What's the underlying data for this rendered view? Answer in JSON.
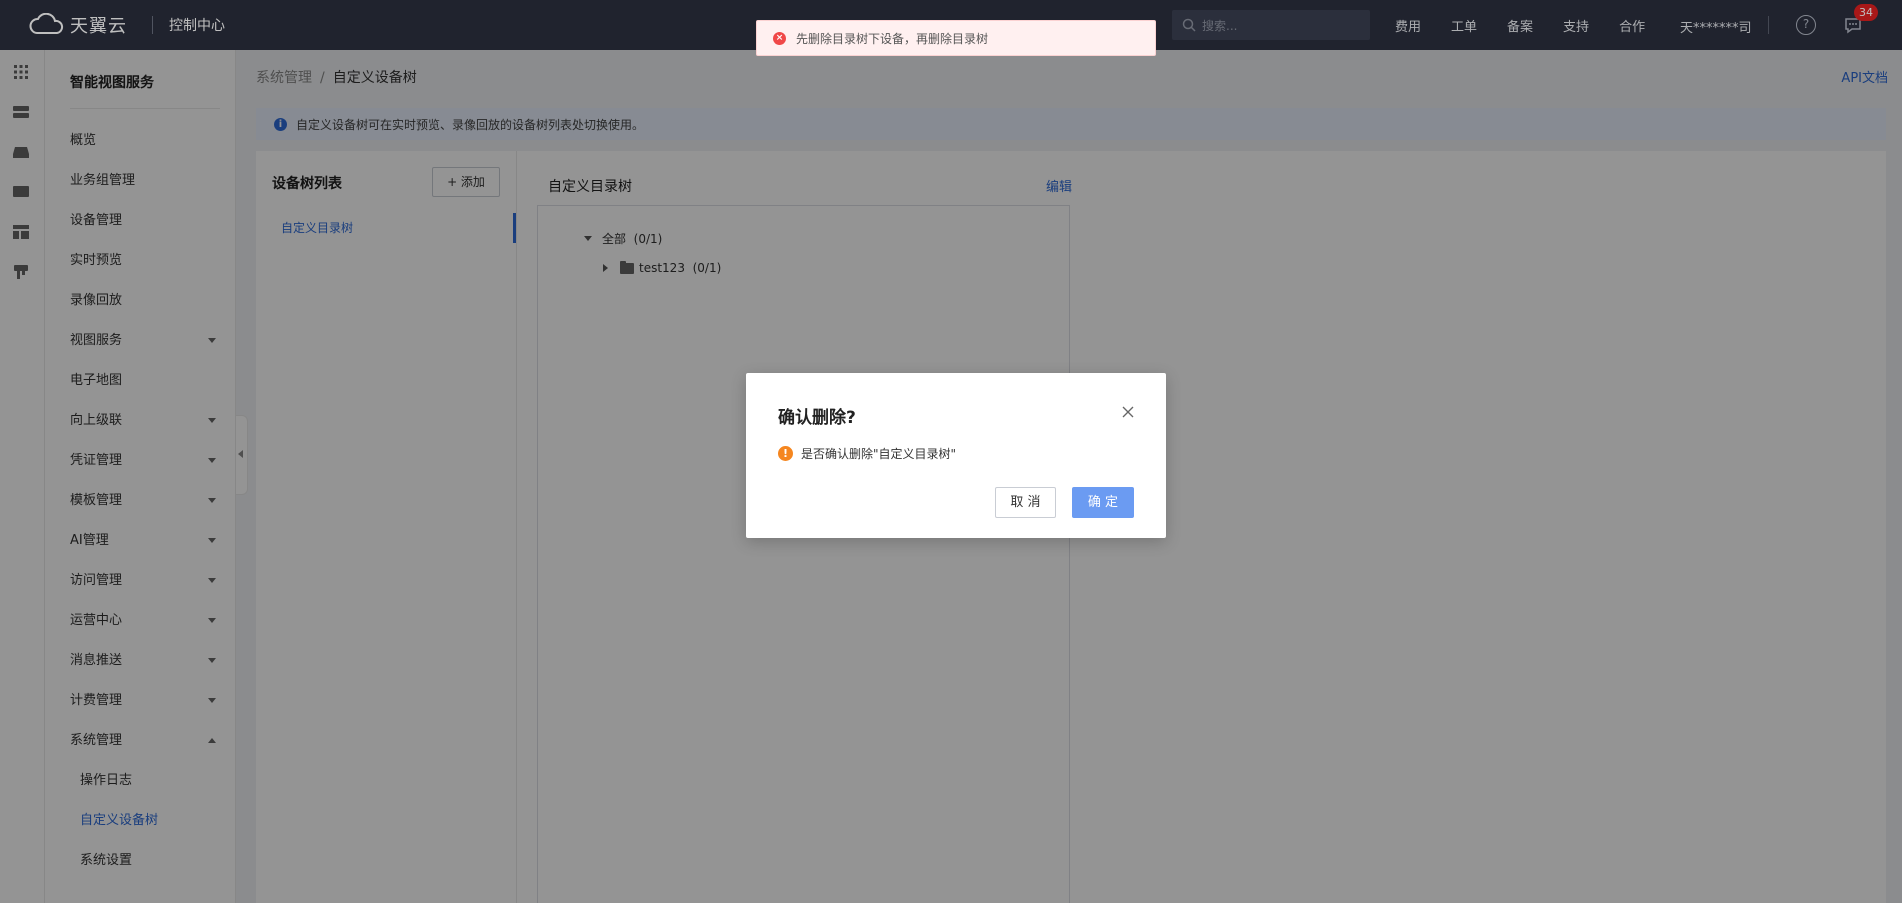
{
  "topbar": {
    "logo_text": "天翼云",
    "console_title": "控制中心",
    "search_placeholder": "搜索...",
    "nav": [
      "费用",
      "工单",
      "备案",
      "支持",
      "合作"
    ],
    "user": "天*******司",
    "help": "?",
    "message_count": "34"
  },
  "sidebar": {
    "title": "智能视图服务",
    "items": [
      {
        "label": "概览",
        "expandable": false
      },
      {
        "label": "业务组管理",
        "expandable": false
      },
      {
        "label": "设备管理",
        "expandable": false
      },
      {
        "label": "实时预览",
        "expandable": false
      },
      {
        "label": "录像回放",
        "expandable": false
      },
      {
        "label": "视图服务",
        "expandable": true
      },
      {
        "label": "电子地图",
        "expandable": false
      },
      {
        "label": "向上级联",
        "expandable": true
      },
      {
        "label": "凭证管理",
        "expandable": true
      },
      {
        "label": "模板管理",
        "expandable": true
      },
      {
        "label": "AI管理",
        "expandable": true
      },
      {
        "label": "访问管理",
        "expandable": true
      },
      {
        "label": "运营中心",
        "expandable": true
      },
      {
        "label": "消息推送",
        "expandable": true
      },
      {
        "label": "计费管理",
        "expandable": true
      },
      {
        "label": "系统管理",
        "expandable": true,
        "expanded": true
      }
    ],
    "sub_items": [
      "操作日志",
      "自定义设备树",
      "系统设置"
    ],
    "active_sub": "自定义设备树"
  },
  "breadcrumb": {
    "parent": "系统管理",
    "sep": "/",
    "current": "自定义设备树"
  },
  "api_link": "API文档",
  "info": {
    "icon": "i",
    "text": "自定义设备树可在实时预览、录像回放的设备树列表处切换使用。"
  },
  "left_panel": {
    "title": "设备树列表",
    "add_label": "+ 添加",
    "items": [
      "自定义目录树"
    ]
  },
  "right_panel": {
    "title": "自定义目录树",
    "edit_label": "编辑",
    "tree": {
      "root_label": "全部",
      "root_count": "(0/1)",
      "child_label": "test123",
      "child_count": "(0/1)"
    }
  },
  "toast": {
    "icon": "×",
    "text": "先删除目录树下设备，再删除目录树"
  },
  "modal": {
    "title": "确认删除?",
    "warn_icon": "!",
    "message": "是否确认删除\"自定义目录树\"",
    "cancel_label": "取 消",
    "ok_label": "确 定"
  },
  "colors": {
    "topbar": "#2b2f3e",
    "accent": "#2e6bd9",
    "primary_button": "#6b9bf2",
    "error": "#f04848",
    "warning": "#f5861f"
  }
}
